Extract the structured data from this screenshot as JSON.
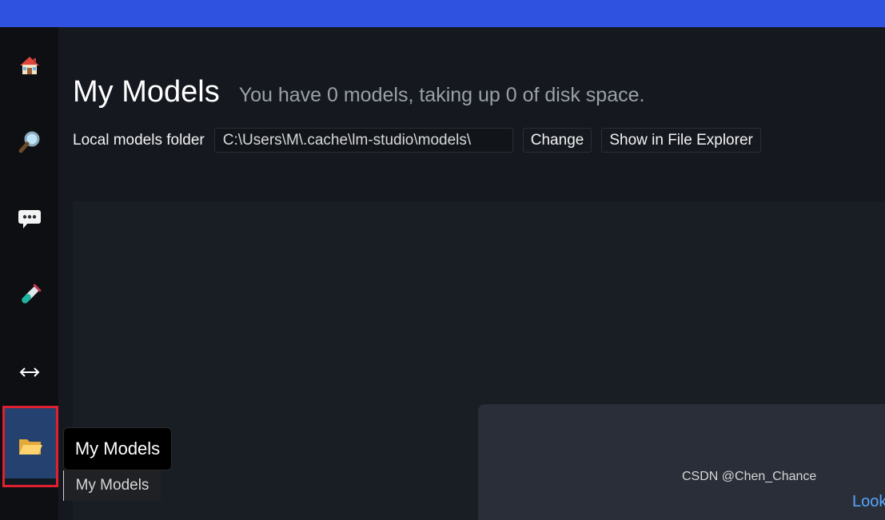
{
  "sidebar": {
    "items": [
      {
        "id": "home",
        "icon": "house-icon"
      },
      {
        "id": "search",
        "icon": "magnifying-glass-icon"
      },
      {
        "id": "chat",
        "icon": "speech-bubble-icon"
      },
      {
        "id": "playground",
        "icon": "test-tube-icon"
      },
      {
        "id": "server",
        "icon": "left-right-arrow-icon"
      },
      {
        "id": "my-models",
        "icon": "open-folder-icon",
        "active": true
      }
    ]
  },
  "header": {
    "title": "My Models",
    "subtitle": "You have 0 models, taking up 0 of disk space."
  },
  "folder": {
    "label": "Local models folder",
    "path": "C:\\Users\\M\\.cache\\lm-studio\\models\\",
    "change_label": "Change",
    "show_label": "Show in File Explorer"
  },
  "content": {
    "link_partial": "Look"
  },
  "tooltip": {
    "primary": "My Models",
    "secondary": "My Models"
  },
  "watermark": "CSDN @Chen_Chance",
  "colors": {
    "topbar": "#2f52e0",
    "sidebar": "#0d0f13",
    "active_item": "#24416f",
    "highlight_border": "#e0202e",
    "link": "#58a6ff"
  }
}
